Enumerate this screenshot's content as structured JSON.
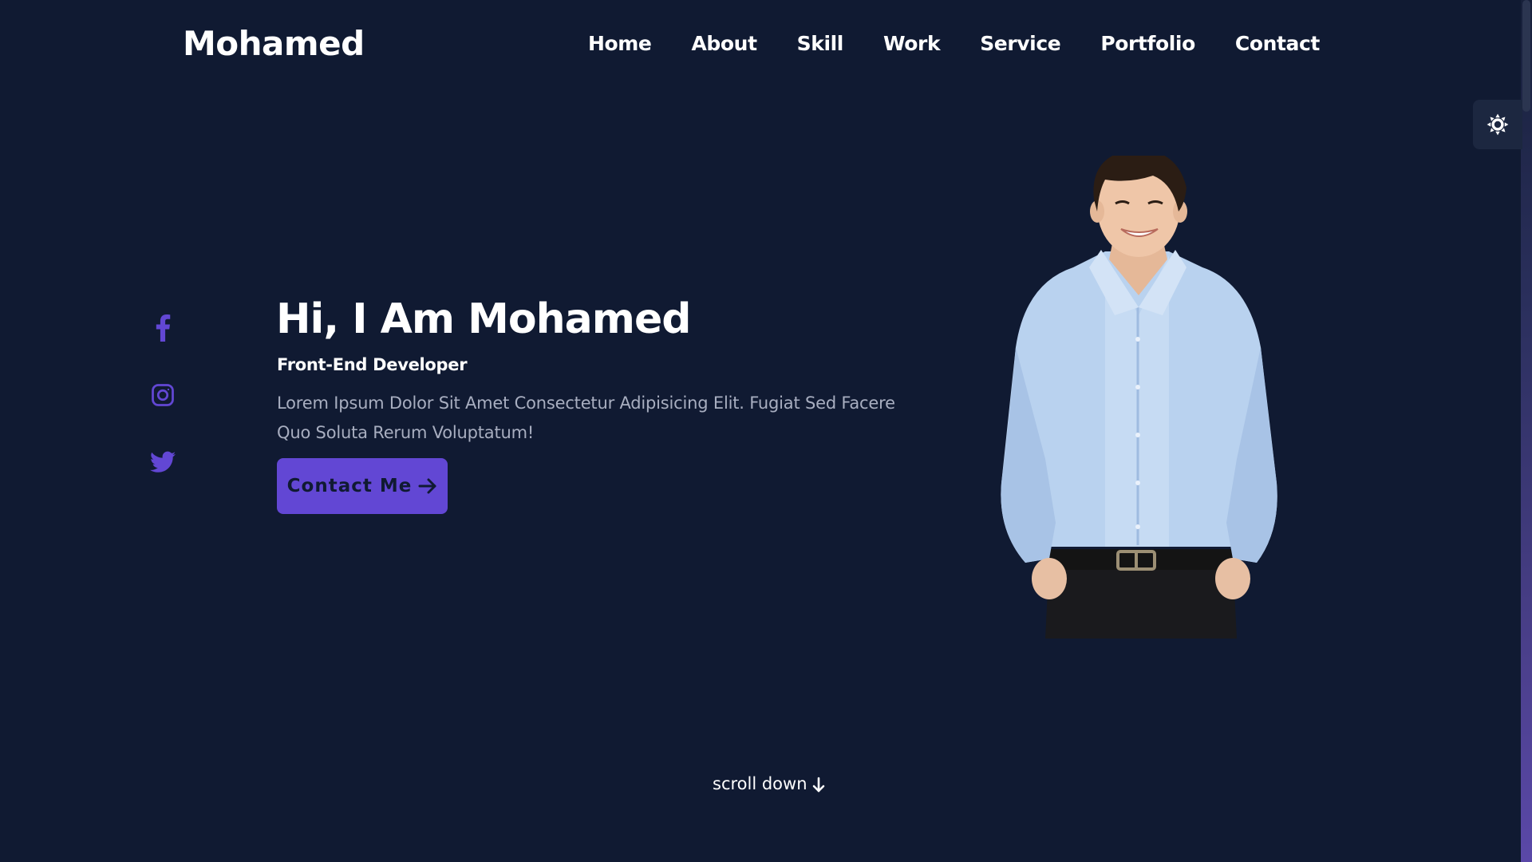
{
  "header": {
    "logo": "Mohamed",
    "nav": [
      "Home",
      "About",
      "Skill",
      "Work",
      "Service",
      "Portfolio",
      "Contact"
    ]
  },
  "theme_toggle": {
    "icon": "sun-icon"
  },
  "social": [
    {
      "icon": "facebook-icon"
    },
    {
      "icon": "instagram-icon"
    },
    {
      "icon": "twitter-icon"
    }
  ],
  "hero": {
    "title": "Hi, I Am Mohamed",
    "subtitle": "Front-End Developer",
    "description": "Lorem Ipsum Dolor Sit Amet Consectetur Adipisicing Elit. Fugiat Sed Facere Quo Soluta Rerum Voluptatum!",
    "button_label": "Contact Me",
    "button_icon": "arrow-right-icon"
  },
  "scroll": {
    "label": "scroll down",
    "icon": "arrow-down-icon"
  },
  "colors": {
    "background": "#101a32",
    "accent": "#6247d4",
    "text": "#ffffff",
    "muted_text": "#a8aec0"
  }
}
